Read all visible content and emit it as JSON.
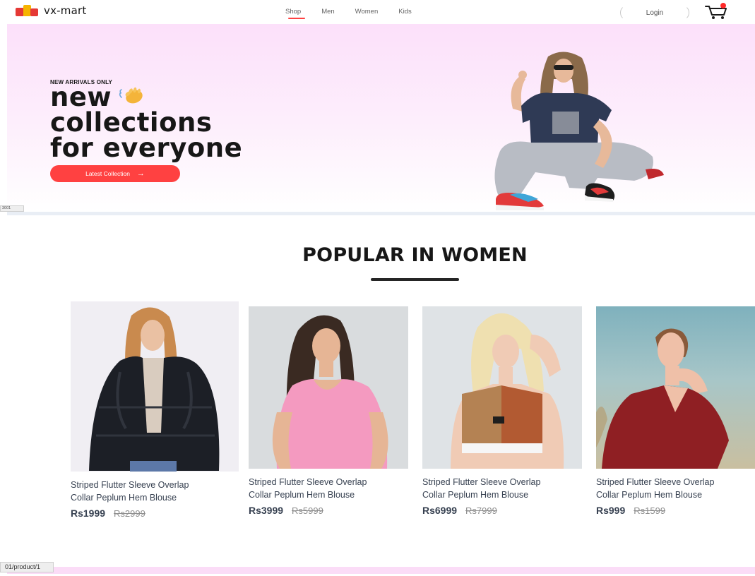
{
  "brand": {
    "name": "vx-mart"
  },
  "nav": {
    "items": [
      {
        "label": "Shop"
      },
      {
        "label": "Men"
      },
      {
        "label": "Women"
      },
      {
        "label": "Kids"
      }
    ],
    "active": "Shop",
    "login_label": "Login",
    "cart_icon": "cart-icon"
  },
  "hero": {
    "tag": "NEW ARRIVALS ONLY",
    "title_lines": [
      "new",
      "collections",
      "for everyone"
    ],
    "hand_icon": "waving-hand-icon",
    "cta_label": "Latest Collection",
    "cta_arrow": "→"
  },
  "status": {
    "top_url": "3001",
    "bottom_url": "01/product/1"
  },
  "popular": {
    "title": "POPULAR IN WOMEN",
    "products": [
      {
        "name_line1": "Striped Flutter Sleeve Overlap",
        "name_line2": "Collar Peplum Hem Blouse",
        "new_price": "Rs1999",
        "old_price": "Rs2999"
      },
      {
        "name_line1": "Striped Flutter Sleeve Overlap",
        "name_line2": "Collar Peplum Hem Blouse",
        "new_price": "Rs3999",
        "old_price": "Rs5999"
      },
      {
        "name_line1": "Striped Flutter Sleeve Overlap",
        "name_line2": "Collar Peplum Hem Blouse",
        "new_price": "Rs6999",
        "old_price": "Rs7999"
      },
      {
        "name_line1": "Striped Flutter Sleeve Overlap",
        "name_line2": "Collar Peplum Hem Blouse",
        "new_price": "Rs999",
        "old_price": "Rs1599"
      }
    ]
  },
  "colors": {
    "accent": "#ff4141",
    "hero_bg": "#fce0fa",
    "text_dark": "#171717",
    "price_text": "#374151"
  }
}
